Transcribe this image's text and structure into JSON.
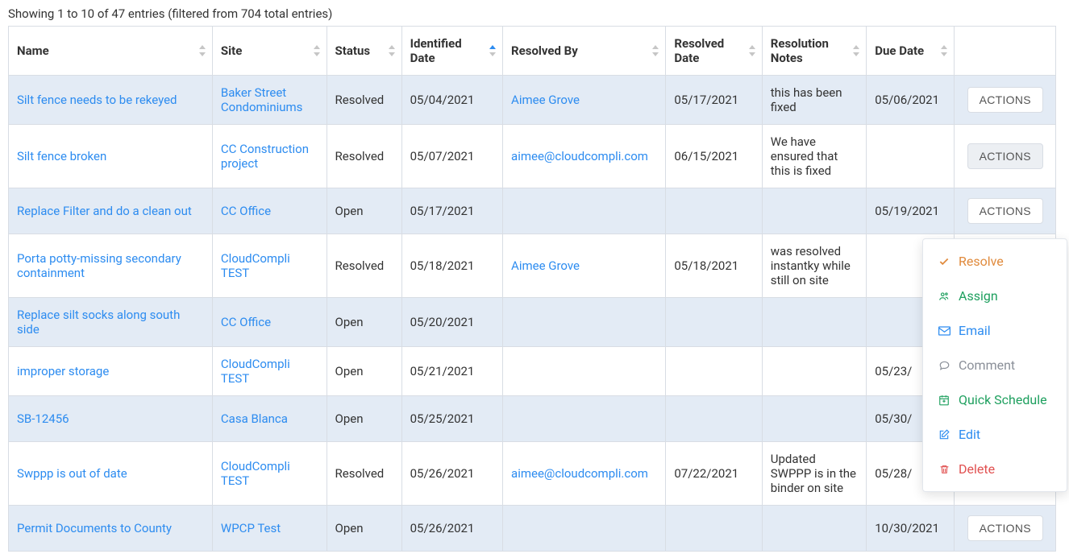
{
  "info_text": "Showing 1 to 10 of 47 entries (filtered from 704 total entries)",
  "columns": {
    "name": "Name",
    "site": "Site",
    "status": "Status",
    "identified_date": "Identified Date",
    "resolved_by": "Resolved By",
    "resolved_date": "Resolved Date",
    "resolution_notes": "Resolution Notes",
    "due_date": "Due Date"
  },
  "actions_label": "ACTIONS",
  "rows": [
    {
      "name": "Silt fence needs to be rekeyed",
      "site": "Baker Street Condominiums",
      "status": "Resolved",
      "identified": "05/04/2021",
      "resolved_by": "Aimee Grove",
      "resolved_date": "05/17/2021",
      "notes": "this has been fixed",
      "due": "05/06/2021",
      "resolved_by_is_email": false
    },
    {
      "name": "Silt fence broken",
      "site": "CC Construction project",
      "status": "Resolved",
      "identified": "05/07/2021",
      "resolved_by": "aimee@cloudcompli.com",
      "resolved_date": "06/15/2021",
      "notes": "We have ensured that this is fixed",
      "due": "",
      "resolved_by_is_email": true
    },
    {
      "name": "Replace Filter and do a clean out",
      "site": "CC Office",
      "status": "Open",
      "identified": "05/17/2021",
      "resolved_by": "",
      "resolved_date": "",
      "notes": "",
      "due": "05/19/2021",
      "resolved_by_is_email": false
    },
    {
      "name": "Porta potty-missing secondary containment",
      "site": "CloudCompli TEST",
      "status": "Resolved",
      "identified": "05/18/2021",
      "resolved_by": "Aimee Grove",
      "resolved_date": "05/18/2021",
      "notes": "was resolved instantky while still on site",
      "due": "",
      "resolved_by_is_email": false
    },
    {
      "name": "Replace silt socks along south side",
      "site": "CC Office",
      "status": "Open",
      "identified": "05/20/2021",
      "resolved_by": "",
      "resolved_date": "",
      "notes": "",
      "due": "",
      "resolved_by_is_email": false
    },
    {
      "name": "improper storage",
      "site": "CloudCompli TEST",
      "status": "Open",
      "identified": "05/21/2021",
      "resolved_by": "",
      "resolved_date": "",
      "notes": "",
      "due": "05/23/",
      "resolved_by_is_email": false
    },
    {
      "name": "SB-12456",
      "site": "Casa Blanca",
      "status": "Open",
      "identified": "05/25/2021",
      "resolved_by": "",
      "resolved_date": "",
      "notes": "",
      "due": "05/30/",
      "resolved_by_is_email": false
    },
    {
      "name": "Swppp is out of date",
      "site": "CloudCompli TEST",
      "status": "Resolved",
      "identified": "05/26/2021",
      "resolved_by": "aimee@cloudcompli.com",
      "resolved_date": "07/22/2021",
      "notes": "Updated SWPPP is in the binder on site",
      "due": "05/28/",
      "resolved_by_is_email": true
    },
    {
      "name": "Permit Documents to County",
      "site": "WPCP Test",
      "status": "Open",
      "identified": "05/26/2021",
      "resolved_by": "",
      "resolved_date": "",
      "notes": "",
      "due": "10/30/2021",
      "resolved_by_is_email": false
    }
  ],
  "dropdown": {
    "resolve": "Resolve",
    "assign": "Assign",
    "email": "Email",
    "comment": "Comment",
    "quick_schedule": "Quick Schedule",
    "edit": "Edit",
    "delete": "Delete"
  }
}
